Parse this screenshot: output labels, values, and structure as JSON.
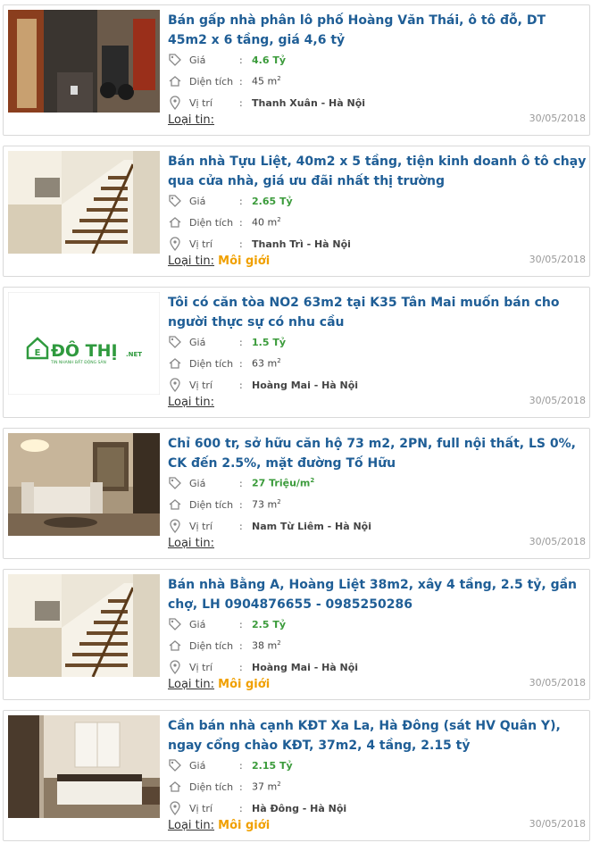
{
  "labels": {
    "price": "Giá",
    "area": "Diện tích",
    "location": "Vị trí",
    "colon": ":",
    "type": "Loại tin:"
  },
  "icons": {
    "price": "price-tag-icon",
    "area": "house-area-icon",
    "location": "location-pin-icon"
  },
  "colors": {
    "title": "#1f5e96",
    "price": "#3b9b3b",
    "type_value": "#f0a000",
    "date": "#999999"
  },
  "listings": [
    {
      "title": "Bán gấp nhà phân lô phố Hoàng Văn Thái, ô tô đỗ, DT 45m2 x 6 tầng, giá 4,6 tỷ",
      "price": "4.6 Tỷ",
      "area": "45 m",
      "area_unit_sup": "2",
      "location": "Thanh Xuân - Hà Nội",
      "type_value": "",
      "date": "30/05/2018",
      "image": "photo-stairway-motorbike"
    },
    {
      "title": "Bán nhà Tựu Liệt, 40m2 x 5 tầng, tiện kinh doanh ô tô chạy qua cửa nhà, giá ưu đãi nhất thị trường",
      "price": "2.65 Tỷ",
      "area": "40 m",
      "area_unit_sup": "2",
      "location": "Thanh Trì - Hà Nội",
      "type_value": "Môi giới",
      "date": "30/05/2018",
      "image": "photo-interior-staircase"
    },
    {
      "title": "Tôi có căn tòa NO2 63m2 tại K35 Tân Mai muốn bán cho người thực sự có nhu cầu",
      "price": "1.5 Tỷ",
      "area": "63 m",
      "area_unit_sup": "2",
      "location": "Hoàng Mai - Hà Nội",
      "type_value": "",
      "date": "30/05/2018",
      "image": "logo-dothi",
      "logo_text": "ĐÔ THỊ",
      "logo_suffix": ".NET",
      "logo_tagline": "TIN NHANH BẤT ĐỘNG SẢN"
    },
    {
      "title": "Chỉ 600 tr, sở hữu căn hộ 73 m2, 2PN, full nội thất, LS 0%, CK đến 2.5%, mặt đường Tố Hữu",
      "price": "27 Triệu/m",
      "price_sup": "2",
      "area": "73 m",
      "area_unit_sup": "2",
      "location": "Nam Từ Liêm - Hà Nội",
      "type_value": "",
      "date": "30/05/2018",
      "image": "photo-living-room"
    },
    {
      "title": "Bán nhà Bằng A, Hoàng Liệt 38m2, xây 4 tầng, 2.5 tỷ, gần chợ, LH 0904876655 - 0985250286",
      "price": "2.5 Tỷ",
      "area": "38 m",
      "area_unit_sup": "2",
      "location": "Hoàng Mai - Hà Nội",
      "type_value": "Môi giới",
      "date": "30/05/2018",
      "image": "photo-interior-staircase"
    },
    {
      "title": "Cần bán nhà cạnh KĐT Xa La, Hà Đông (sát HV Quân Y), ngay cổng chào KĐT, 37m2, 4 tầng, 2.15 tỷ",
      "price": "2.15 Tỷ",
      "area": "37 m",
      "area_unit_sup": "2",
      "location": "Hà Đông - Hà Nội",
      "type_value": "Môi giới",
      "date": "30/05/2018",
      "image": "photo-bedroom"
    }
  ]
}
